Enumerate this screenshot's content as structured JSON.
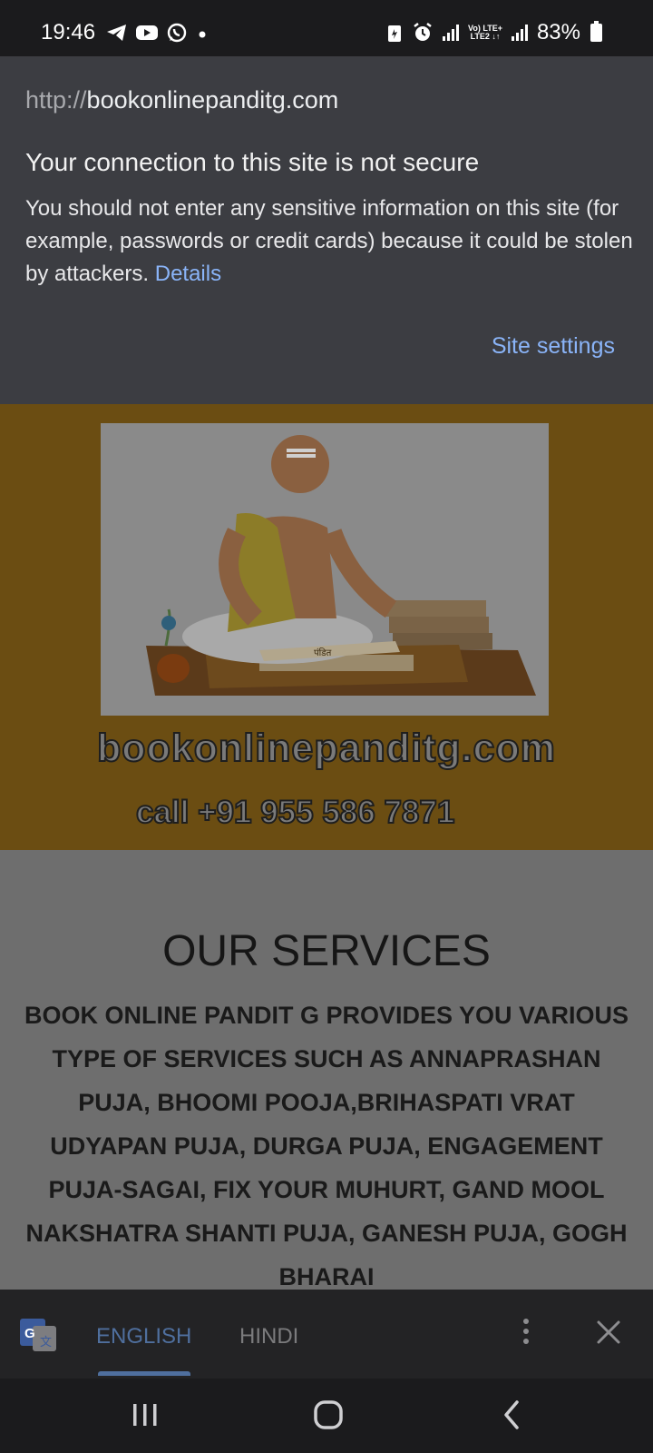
{
  "status_bar": {
    "time": "19:46",
    "battery": "83%",
    "left_icons": [
      "telegram-icon",
      "youtube-icon",
      "whatsapp-icon",
      "notification-dot-icon"
    ],
    "right_icons": [
      "battery-saver-icon",
      "alarm-icon",
      "signal-icon",
      "volte-icon",
      "signal-icon",
      "battery-icon"
    ],
    "network_top": "Vo) LTE+",
    "network_bottom": "LTE2 ↓↑"
  },
  "security_sheet": {
    "url_protocol": "http://",
    "url_host": "bookonlinepanditg.com",
    "title": "Your connection to this site is not secure",
    "body": "You should not enter any sensitive information on this site (for example, passwords or credit cards) because it could be stolen by attackers.",
    "details_link": "Details",
    "site_settings_link": "Site settings"
  },
  "web_page": {
    "banner_url": "bookonlinepanditg.com",
    "banner_phone": "call +91 955 586 7871",
    "hero_image_label": "पंडित",
    "services_title": "OUR SERVICES",
    "services_text": "BOOK ONLINE PANDIT G PROVIDES YOU VARIOUS TYPE OF SERVICES SUCH AS ANNAPRASHAN PUJA, BHOOMI POOJA,BRIHASPATI VRAT UDYAPAN PUJA, DURGA PUJA, ENGAGEMENT PUJA-SAGAI, FIX YOUR MUHURT, GAND MOOL NAKSHATRA SHANTI PUJA, GANESH PUJA, GOGH BHARAI"
  },
  "translate_bar": {
    "languages": [
      "ENGLISH",
      "HINDI"
    ],
    "selected": "ENGLISH"
  },
  "nav_bar": {
    "buttons": [
      "recent-apps",
      "home",
      "back"
    ]
  },
  "colors": {
    "sheet_bg": "#3c3d42",
    "link": "#8ab4f8",
    "banner_bg": "#6b4d12",
    "page_bg": "#6e6e6e"
  }
}
